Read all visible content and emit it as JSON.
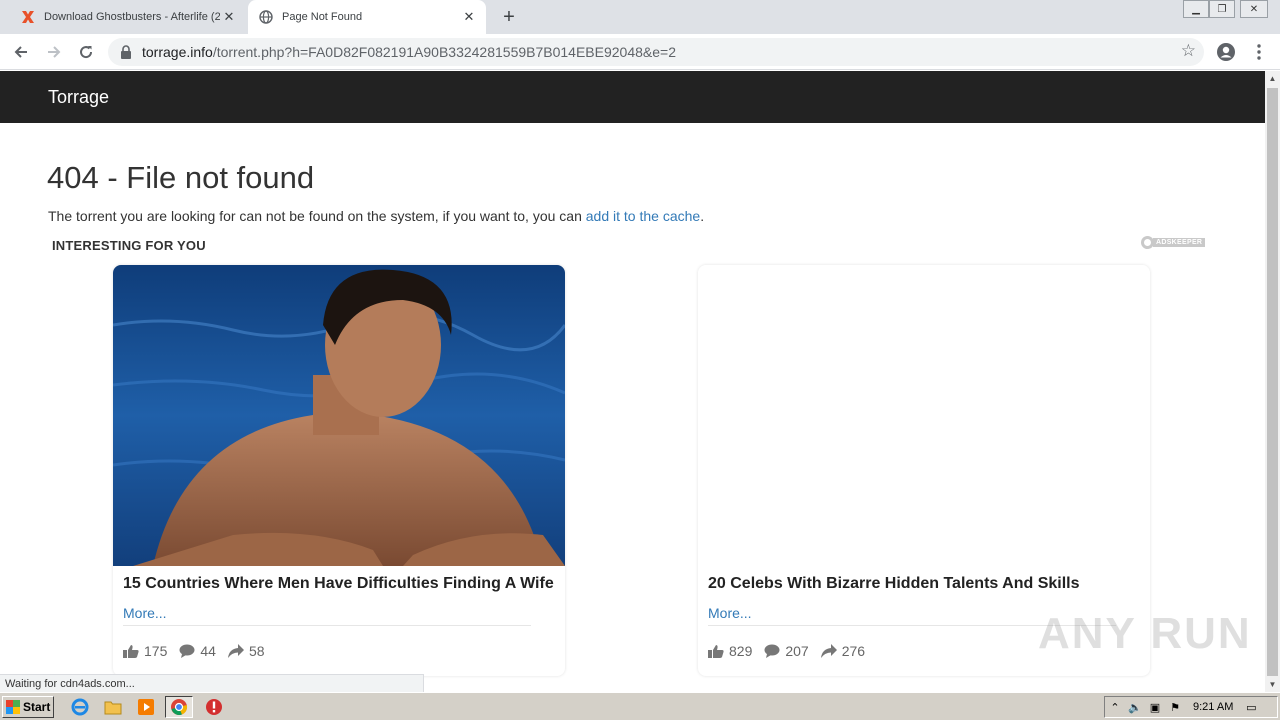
{
  "browser": {
    "tabs": [
      {
        "title": "Download Ghostbusters - Afterlife (2",
        "active": false,
        "favicon": "x-logo-icon"
      },
      {
        "title": "Page Not Found",
        "active": true,
        "favicon": "globe-icon"
      }
    ],
    "new_tab": "+",
    "url_domain": "torrage.info",
    "url_path": "/torrent.php?h=FA0D82F082191A90B3324281559B7B014EBE92048&e=2"
  },
  "site": {
    "brand": "Torrage",
    "heading": "404 - File not found",
    "message": "The torrent you are looking for can not be found on the system, if you want to, you can ",
    "link_text": "add it to the cache",
    "message_end": ".",
    "section_title": "INTERESTING FOR YOU",
    "ad_badge": "ADSKEEPER"
  },
  "cards": [
    {
      "title": "15 Countries Where Men Have Difficulties Finding A Wife",
      "more": "More...",
      "likes": "175",
      "comments": "44",
      "shares": "58"
    },
    {
      "title": "20 Celebs With Bizarre Hidden Talents And Skills",
      "more": "More...",
      "likes": "829",
      "comments": "207",
      "shares": "276"
    }
  ],
  "status_text": "Waiting for cdn4ads.com...",
  "watermark": "ANY RUN",
  "taskbar": {
    "start": "Start",
    "clock": "9:21 AM"
  },
  "colors": {
    "nav_bg": "#222222",
    "link": "#337ab7",
    "tab_strip": "#dee1e6"
  }
}
